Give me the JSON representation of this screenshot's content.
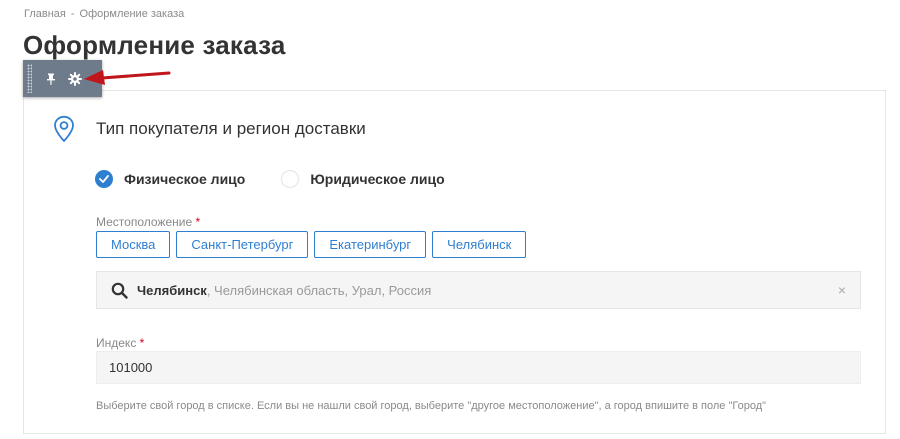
{
  "breadcrumb": {
    "home": "Главная",
    "separator": "-",
    "current": "Оформление заказа"
  },
  "page": {
    "title": "Оформление заказа"
  },
  "toolbar": {
    "pin_icon": "pin-icon",
    "settings_icon": "gear-icon"
  },
  "section": {
    "icon": "location-pin-icon",
    "title": "Тип покупателя и регион доставки"
  },
  "buyer_type": {
    "options": [
      {
        "label": "Физическое лицо",
        "checked": true
      },
      {
        "label": "Юридическое лицо",
        "checked": false
      }
    ]
  },
  "location": {
    "label": "Местоположение",
    "required_mark": "*",
    "quick_cities": [
      "Москва",
      "Санкт-Петербург",
      "Екатеринбург",
      "Челябинск"
    ],
    "selected_city": "Челябинск",
    "selected_region": ", Челябинская область, Урал, Россия",
    "clear_symbol": "×"
  },
  "index": {
    "label": "Индекс",
    "required_mark": "*",
    "value": "101000"
  },
  "hint": "Выберите свой город в списке. Если вы не нашли свой город, выберите \"другое местоположение\", а город впишите в поле \"Город\"",
  "colors": {
    "accent": "#2f7fd1",
    "required": "#d0021b",
    "toolbar_bg": "#6e7b8b",
    "annotation_arrow": "#c0161b"
  }
}
